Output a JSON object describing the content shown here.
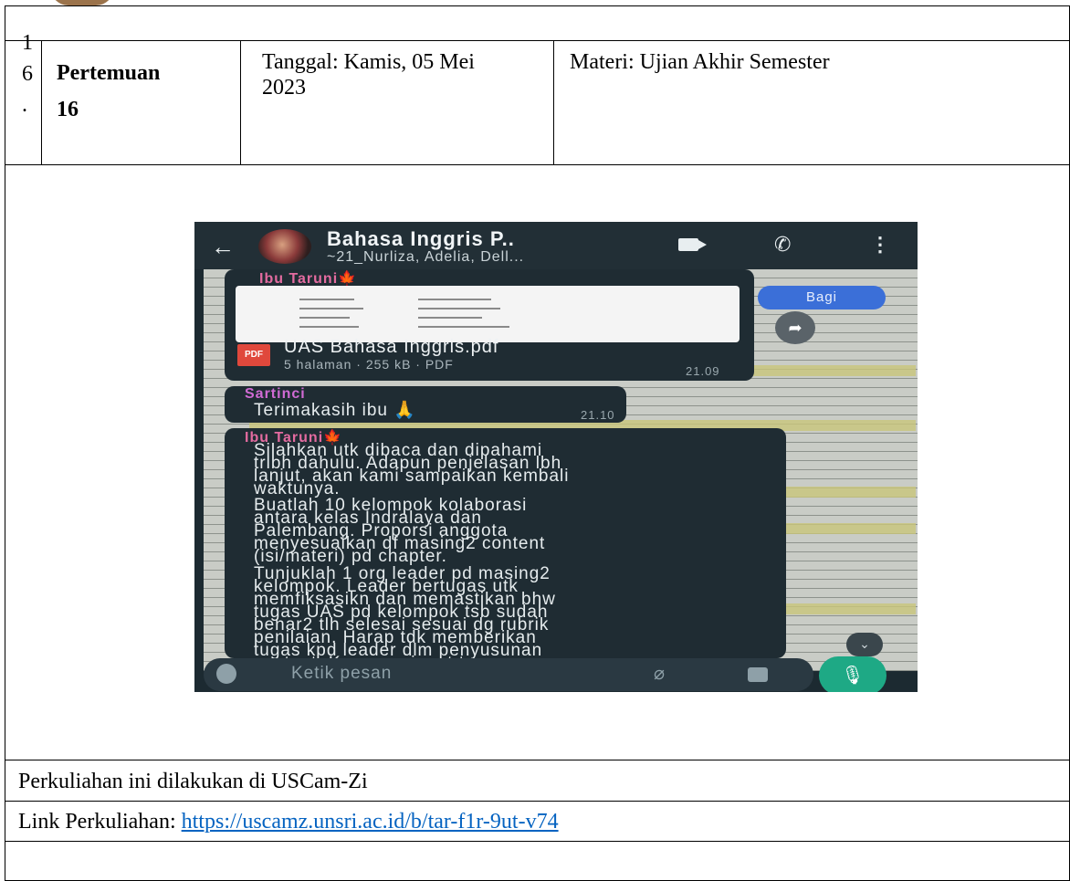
{
  "row": {
    "number_digits": [
      "1",
      "6",
      "."
    ],
    "meeting_label": "Pertemuan",
    "meeting_number": "16",
    "date_line1": "Tanggal: Kamis, 05 Mei",
    "date_line2": "2023",
    "material": "Materi: Ujian Akhir Semester"
  },
  "chat": {
    "group_title": "Bahasa Inggris P..",
    "group_subtitle": "~21_Nurliza, Adelia, Dell...",
    "share_label": "Bagi",
    "msg1": {
      "sender": "Ibu Taruni",
      "sender_emoji": "🍁",
      "file_name": "UAS Bahasa Inggris.pdf",
      "file_meta": "5 halaman · 255 kB · PDF",
      "pdf_badge": "PDF",
      "time": "21.09"
    },
    "msg2": {
      "sender": "Sartinci",
      "text": "Terimakasih ibu 🙏",
      "time": "21.10"
    },
    "msg3": {
      "sender": "Ibu Taruni",
      "sender_emoji": "🍁",
      "para1": "Silahkan utk dibaca dan dipahami\ntrlbh dahulu. Adapun penjelasan lbh\nlanjut, akan kami sampaikan kembali\nwaktunya.",
      "para2": "Buatlah 10 kelompok kolaborasi\nantara kelas Indralaya dan\nPalembang. Proporsi anggota\nmenyesuaikan df masing2 content\n(isi/materi) pd chapter.",
      "para3": "Tunjuklah 1 org leader pd masing2\nkelompok. Leader bertugas utk\nmemfiksasikn dan memastikan bhw\ntugas UAS pd kelompok tsb sudah\nbenar2 tlh selesai sesuai dg rubrik\npenilaian. Harap tdk memberikan\ntugas kpd leader dlm penyusunan\ncontent. Krn mengingat tugas"
    },
    "input_placeholder": "Ketik pesan"
  },
  "footer": {
    "location": "Perkuliahan ini dilakukan di USCam-Zi",
    "link_label": "Link Perkuliahan: ",
    "link_url": "https://uscamz.unsri.ac.id/b/tar-f1r-9ut-v74"
  }
}
